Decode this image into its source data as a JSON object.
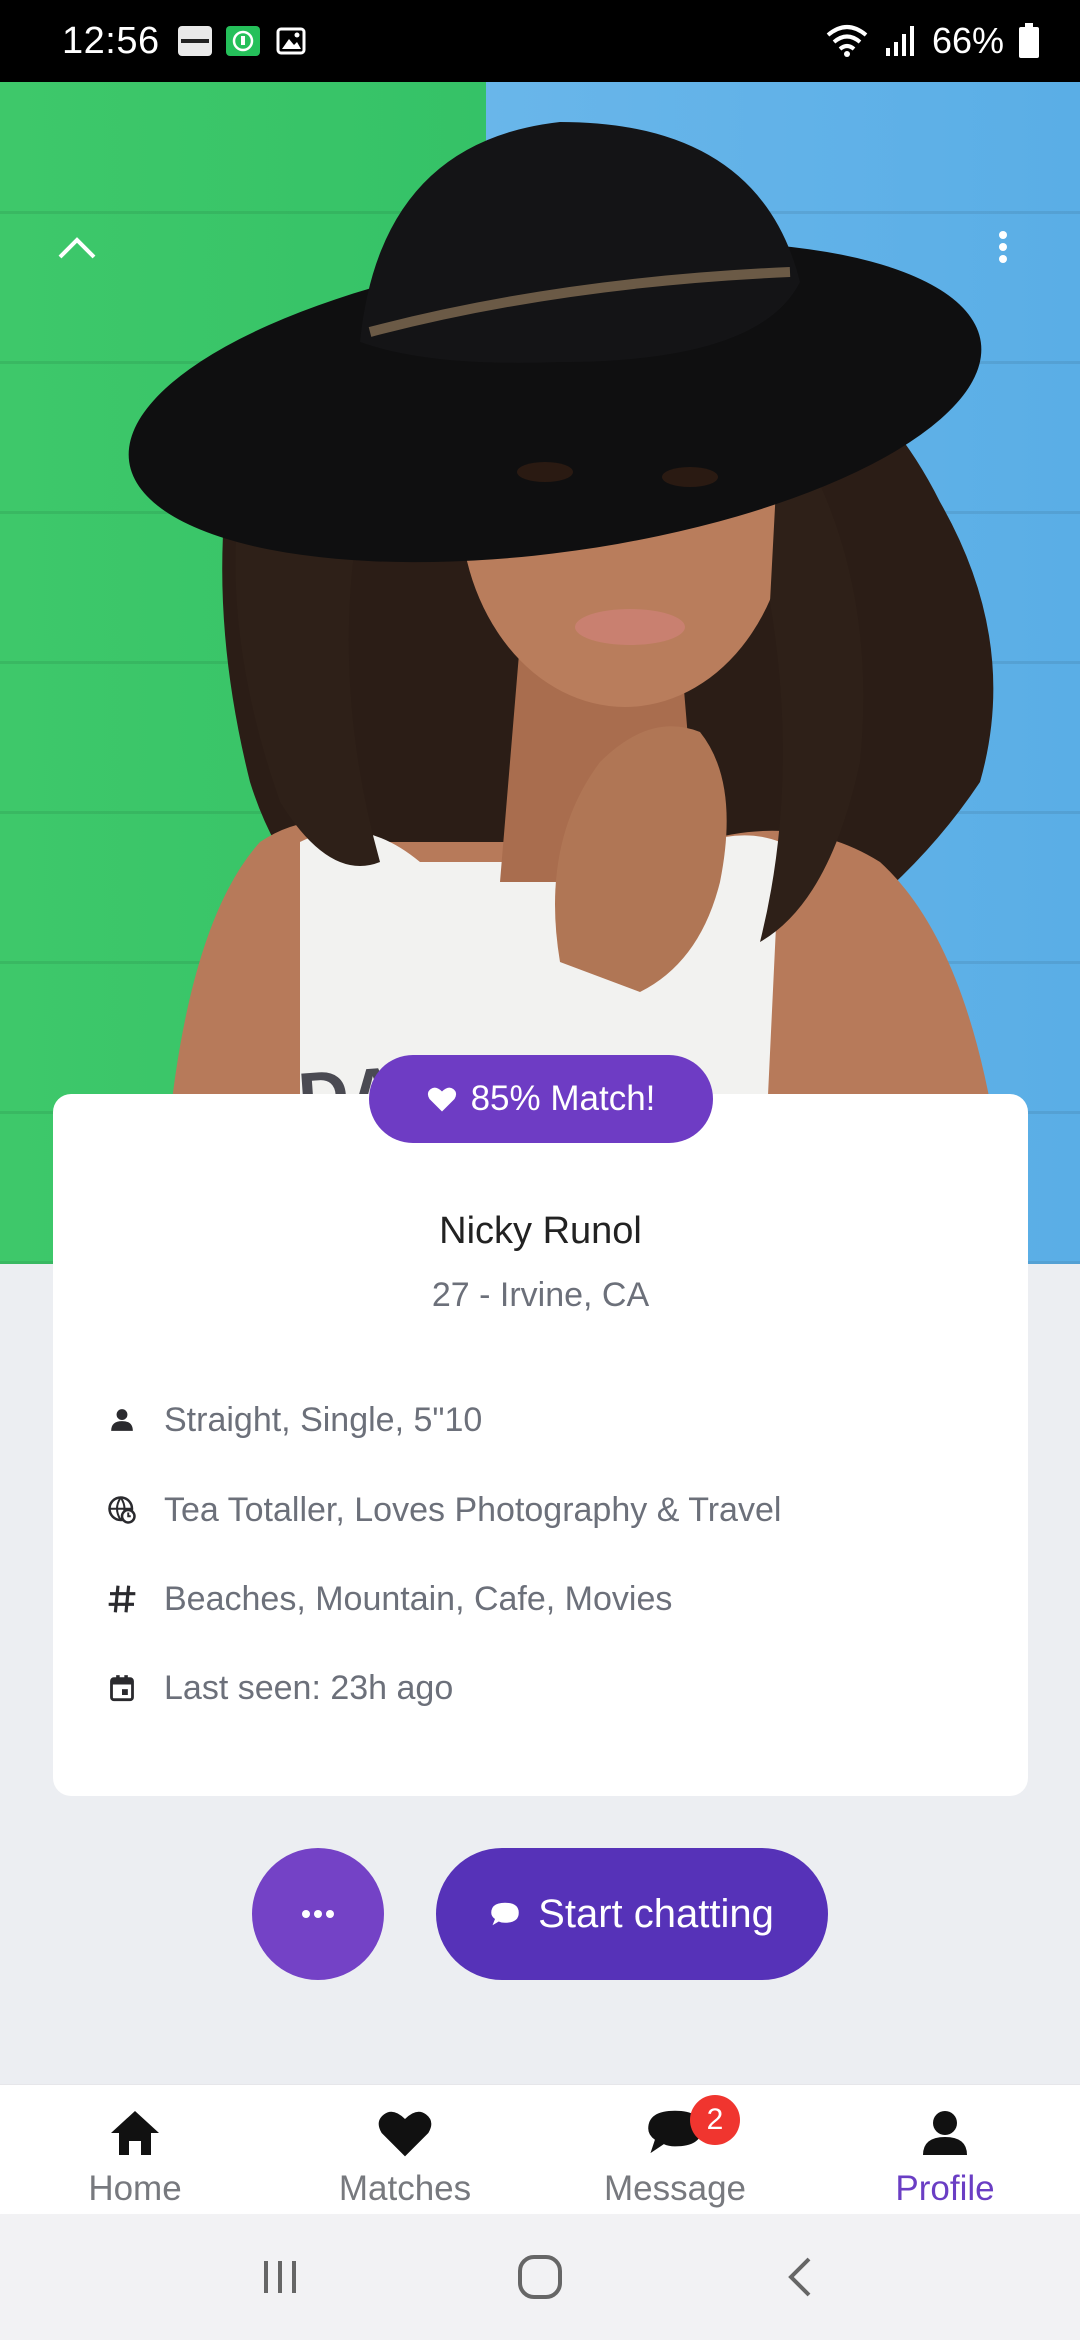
{
  "status_bar": {
    "time": "12:56",
    "battery": "66%",
    "icons": [
      "zomato-icon",
      "whatsapp-business-icon",
      "gallery-icon",
      "wifi-icon",
      "signal-icon",
      "battery-icon"
    ]
  },
  "hero": {
    "shirt_text": "DAVID B",
    "up_icon": "chevron-up-icon",
    "more_icon": "more-vertical-icon"
  },
  "match": {
    "label": "85% Match!",
    "color": "#6e3cc4"
  },
  "profile": {
    "name": "Nicky Runol",
    "subtitle": "27 - Irvine, CA",
    "details": [
      {
        "icon": "person-icon",
        "text": "Straight, Single, 5\"10"
      },
      {
        "icon": "globe-icon",
        "text": "Tea Totaller, Loves Photography & Travel"
      },
      {
        "icon": "hashtag-icon",
        "text": "Beaches, Mountain, Cafe, Movies"
      },
      {
        "icon": "calendar-icon",
        "text": "Last seen: 23h ago"
      }
    ]
  },
  "actions": {
    "more_icon": "more-horizontal-icon",
    "chat_label": "Start chatting",
    "chat_color": "#5632b8"
  },
  "bottom_nav": {
    "items": [
      {
        "label": "Home",
        "icon": "home-icon"
      },
      {
        "label": "Matches",
        "icon": "heart-icon"
      },
      {
        "label": "Message",
        "icon": "chat-icon",
        "badge": "2"
      },
      {
        "label": "Profile",
        "icon": "profile-icon",
        "active": true
      }
    ],
    "active_color": "#6a3ec4"
  },
  "system_nav": [
    "recents-icon",
    "home-circle-icon",
    "back-icon"
  ]
}
